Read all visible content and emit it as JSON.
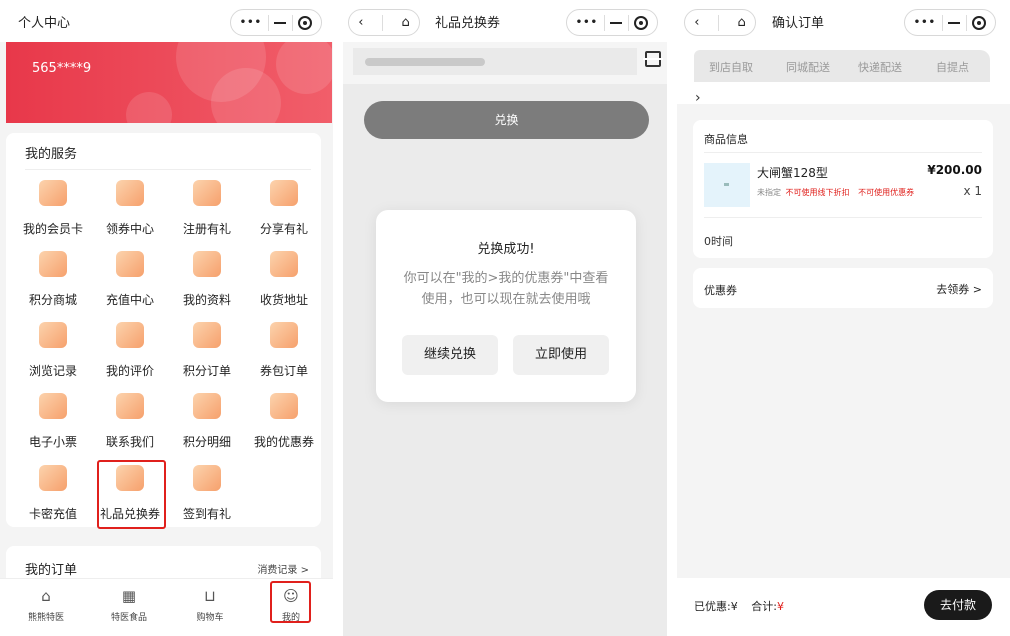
{
  "colors": {
    "brand_red": "#e8384a",
    "accent_red": "#e0201c",
    "dark_button": "#1a1a1a",
    "highlight_box": "#e0201c"
  },
  "screen1": {
    "title": "个人中心",
    "phone": "565****9",
    "services_title": "我的服务",
    "services": [
      {
        "label": "我的会员卡",
        "icon": "crown-icon"
      },
      {
        "label": "领券中心",
        "icon": "ticket-icon"
      },
      {
        "label": "注册有礼",
        "icon": "gift-icon"
      },
      {
        "label": "分享有礼",
        "icon": "paper-plane-icon"
      },
      {
        "label": "积分商城",
        "icon": "store-icon"
      },
      {
        "label": "充值中心",
        "icon": "recharge-icon"
      },
      {
        "label": "我的资料",
        "icon": "profile-doc-icon"
      },
      {
        "label": "收货地址",
        "icon": "location-pin-icon"
      },
      {
        "label": "浏览记录",
        "icon": "footprint-icon"
      },
      {
        "label": "我的评价",
        "icon": "comment-icon"
      },
      {
        "label": "积分订单",
        "icon": "star-icon"
      },
      {
        "label": "券包订单",
        "icon": "coupon-stack-icon"
      },
      {
        "label": "电子小票",
        "icon": "receipt-icon"
      },
      {
        "label": "联系我们",
        "icon": "phone-icon"
      },
      {
        "label": "积分明细",
        "icon": "points-detail-icon"
      },
      {
        "label": "我的优惠券",
        "icon": "my-coupon-icon"
      },
      {
        "label": "卡密充值",
        "icon": "card-icon"
      },
      {
        "label": "礼品兑换券",
        "icon": "gift-box-icon"
      },
      {
        "label": "签到有礼",
        "icon": "checkin-icon"
      }
    ],
    "orders_title": "我的订单",
    "orders_link": "消费记录 >",
    "tabs": [
      {
        "label": "熊熊特医",
        "icon": "home-icon"
      },
      {
        "label": "特医食品",
        "icon": "grid-icon"
      },
      {
        "label": "购物车",
        "icon": "cart-icon"
      },
      {
        "label": "我的",
        "icon": "user-icon"
      }
    ]
  },
  "screen2": {
    "title": "礼品兑换券",
    "redeem_button": "兑换",
    "modal": {
      "title": "兑换成功!",
      "body": "你可以在\"我的>我的优惠券\"中查看使用，也可以现在就去使用哦",
      "continue_button": "继续兑换",
      "use_button": "立即使用"
    }
  },
  "screen3": {
    "title": "确认订单",
    "delivery_tabs": [
      "到店自取",
      "同城配送",
      "快递配送",
      "自提点"
    ],
    "product_section_title": "商品信息",
    "product": {
      "name": "大闸蟹128型",
      "price": "¥200.00",
      "tag_unspecified": "未指定",
      "tag_no_discount": "不可使用线下折扣",
      "tag_no_coupon": "不可使用优惠券",
      "qty": "x 1"
    },
    "time_text": "0时间",
    "coupon_label": "优惠券",
    "coupon_link": "去领券 >",
    "discount_text": "已优惠:¥",
    "total_label": "合计:",
    "total_currency": "¥",
    "pay_button": "去付款"
  }
}
